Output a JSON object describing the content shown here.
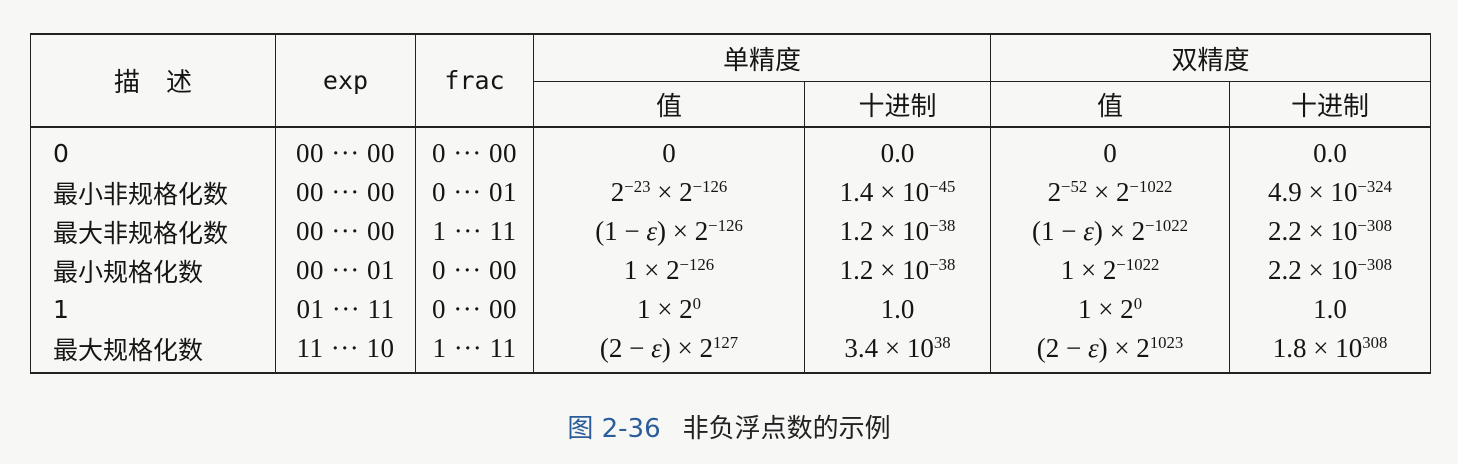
{
  "table": {
    "headers": {
      "description": "描　述",
      "exp": "exp",
      "frac": "frac",
      "single": "单精度",
      "double": "双精度",
      "value": "值",
      "decimal": "十进制"
    },
    "rows": [
      {
        "desc": "0",
        "exp": "00 ··· 00",
        "frac": "0 ··· 00",
        "s_val": "0",
        "s_dec": "0.0",
        "d_val": "0",
        "d_dec": "0.0"
      },
      {
        "desc": "最小非规格化数",
        "exp": "00 ··· 00",
        "frac": "0 ··· 01",
        "s_val": "2<sup>−23</sup> × 2<sup>−126</sup>",
        "s_dec": "1.4 × 10<sup>−45</sup>",
        "d_val": "2<sup>−52</sup> × 2<sup>−1022</sup>",
        "d_dec": "4.9 × 10<sup>−324</sup>"
      },
      {
        "desc": "最大非规格化数",
        "exp": "00 ··· 00",
        "frac": "1 ··· 11",
        "s_val": "(1 − <i>ε</i>) × 2<sup>−126</sup>",
        "s_dec": "1.2 × 10<sup>−38</sup>",
        "d_val": "(1 − <i>ε</i>) × 2<sup>−1022</sup>",
        "d_dec": "2.2 × 10<sup>−308</sup>"
      },
      {
        "desc": "最小规格化数",
        "exp": "00 ··· 01",
        "frac": "0 ··· 00",
        "s_val": "1 × 2<sup>−126</sup>",
        "s_dec": "1.2 × 10<sup>−38</sup>",
        "d_val": "1 × 2<sup>−1022</sup>",
        "d_dec": "2.2 × 10<sup>−308</sup>"
      },
      {
        "desc": "1",
        "exp": "01 ··· 11",
        "frac": "0 ··· 00",
        "s_val": "1 × 2<sup>0</sup>",
        "s_dec": "1.0",
        "d_val": "1 × 2<sup>0</sup>",
        "d_dec": "1.0"
      },
      {
        "desc": "最大规格化数",
        "exp": "11 ··· 10",
        "frac": "1 ··· 11",
        "s_val": "(2 − <i>ε</i>) × 2<sup>127</sup>",
        "s_dec": "3.4 × 10<sup>38</sup>",
        "d_val": "(2 − <i>ε</i>) × 2<sup>1023</sup>",
        "d_dec": "1.8 × 10<sup>308</sup>"
      }
    ]
  },
  "caption": {
    "number": "图 2-36",
    "text": "非负浮点数的示例"
  },
  "colors": {
    "caption_number": "#2a5d9a",
    "rule": "#222222"
  }
}
